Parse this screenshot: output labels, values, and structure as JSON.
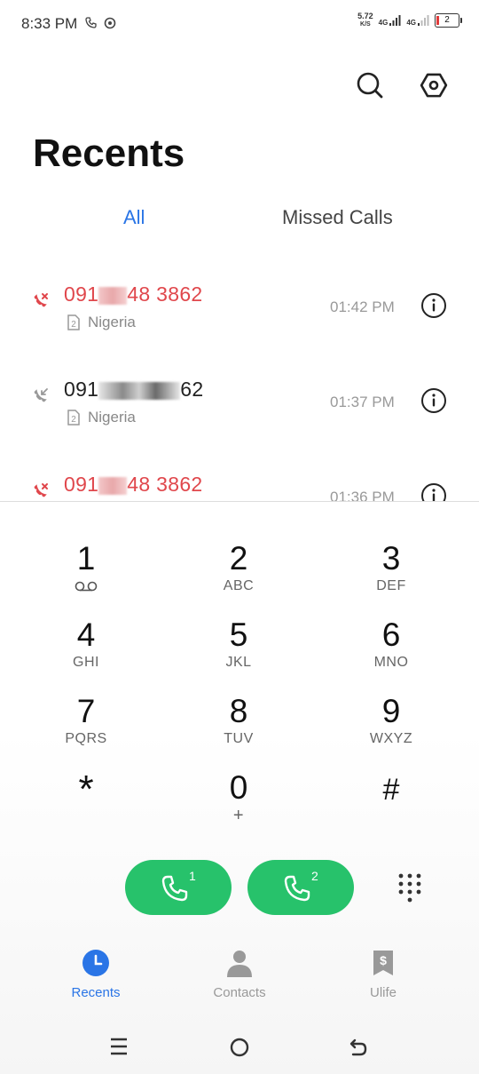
{
  "status_bar": {
    "time": "8:33 PM",
    "net_speed_value": "5.72",
    "net_speed_unit": "K/S",
    "sim1_network": "4G",
    "sim2_network": "4G",
    "battery_level": "2"
  },
  "header": {
    "title": "Recents"
  },
  "tabs": [
    {
      "label": "All",
      "active": true
    },
    {
      "label": "Missed Calls",
      "active": false
    }
  ],
  "calls": [
    {
      "number_prefix": "091",
      "number_suffix": "48 3862",
      "location": "Nigeria",
      "sim": "2",
      "time": "01:42 PM",
      "type": "missed"
    },
    {
      "number_prefix": "091",
      "number_suffix": "62",
      "location": "Nigeria",
      "sim": "2",
      "time": "01:37 PM",
      "type": "incoming"
    },
    {
      "number_prefix": "091",
      "number_suffix": "48 3862",
      "location": "",
      "sim": "2",
      "time": "01:36 PM",
      "type": "missed"
    }
  ],
  "keypad": [
    {
      "digit": "1",
      "letters": ""
    },
    {
      "digit": "2",
      "letters": "ABC"
    },
    {
      "digit": "3",
      "letters": "DEF"
    },
    {
      "digit": "4",
      "letters": "GHI"
    },
    {
      "digit": "5",
      "letters": "JKL"
    },
    {
      "digit": "6",
      "letters": "MNO"
    },
    {
      "digit": "7",
      "letters": "PQRS"
    },
    {
      "digit": "8",
      "letters": "TUV"
    },
    {
      "digit": "9",
      "letters": "WXYZ"
    },
    {
      "digit": "*",
      "letters": ""
    },
    {
      "digit": "0",
      "letters": "+"
    },
    {
      "digit": "#",
      "letters": ""
    }
  ],
  "call_buttons": [
    {
      "sim": "1"
    },
    {
      "sim": "2"
    }
  ],
  "bottom_nav": [
    {
      "label": "Recents",
      "active": true
    },
    {
      "label": "Contacts",
      "active": false
    },
    {
      "label": "Ulife",
      "active": false
    }
  ],
  "colors": {
    "accent": "#2a75e6",
    "missed": "#e0474c",
    "call_green": "#27c26b"
  }
}
